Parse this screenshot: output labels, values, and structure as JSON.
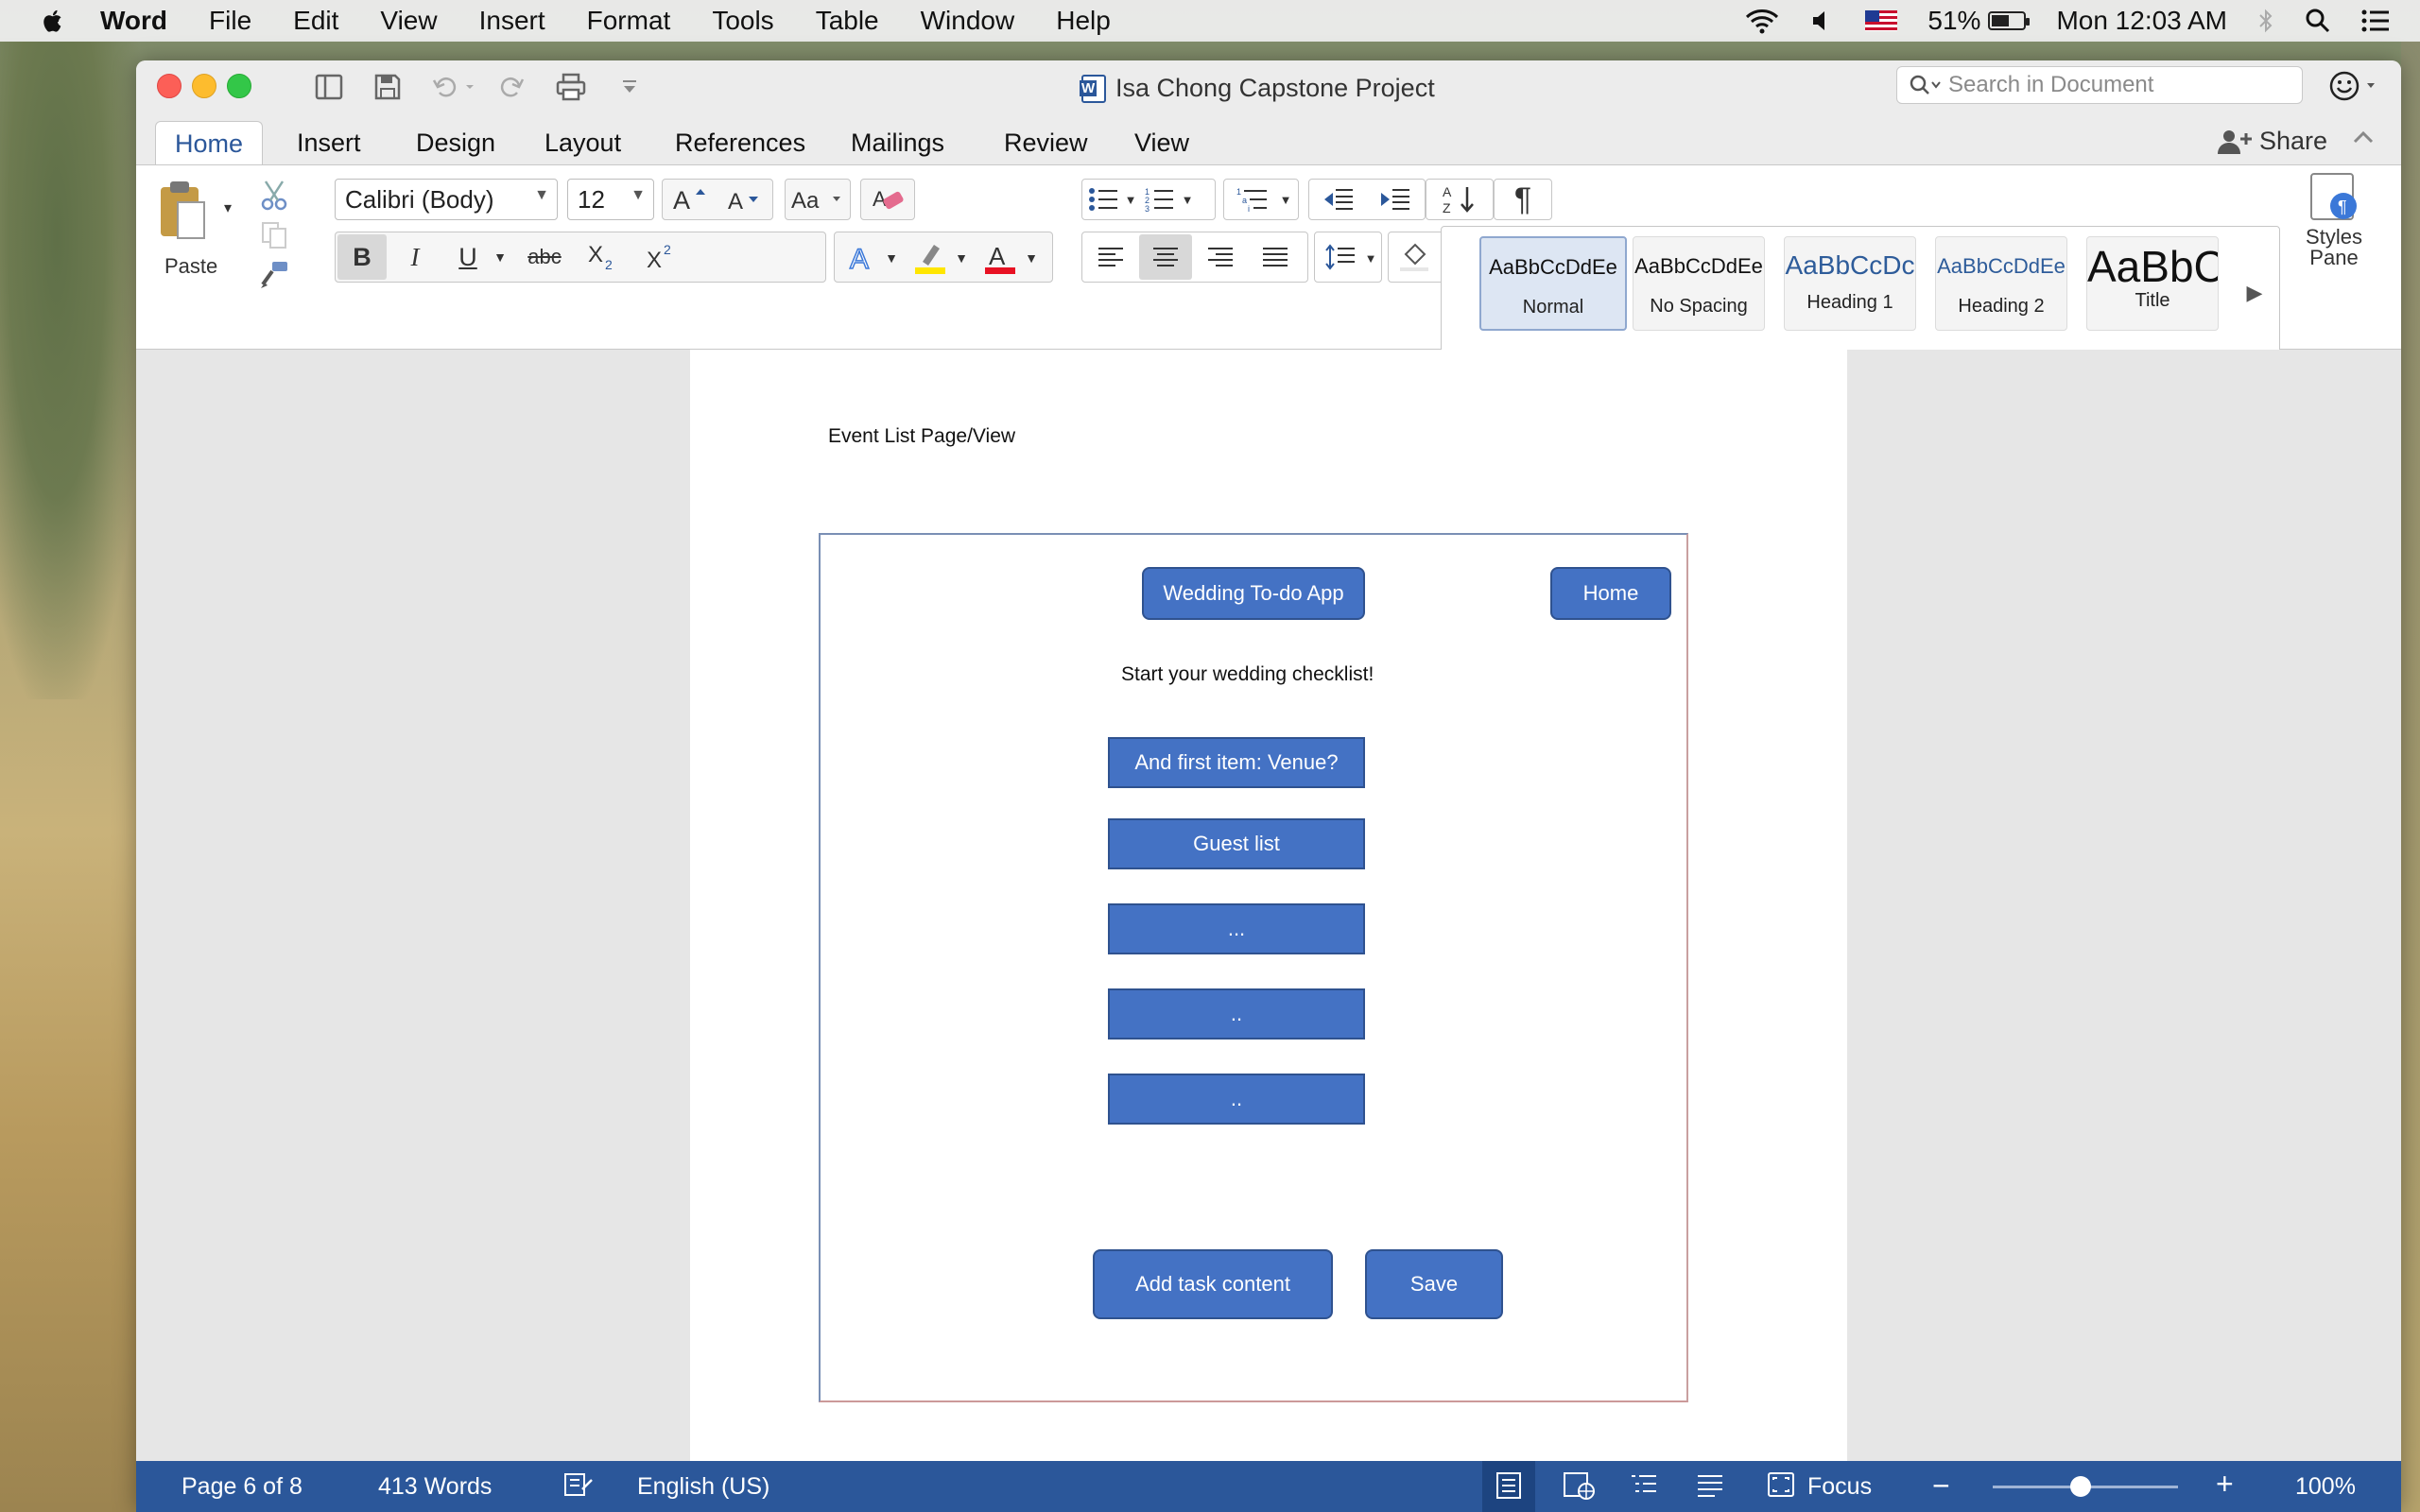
{
  "menubar": {
    "app": "Word",
    "items": [
      "File",
      "Edit",
      "View",
      "Insert",
      "Format",
      "Tools",
      "Table",
      "Window",
      "Help"
    ],
    "battery": "51%",
    "clock": "Mon 12:03 AM"
  },
  "window": {
    "title": "Isa Chong Capstone Project",
    "search_placeholder": "Search in Document",
    "share": "Share"
  },
  "tabs": [
    "Home",
    "Insert",
    "Design",
    "Layout",
    "References",
    "Mailings",
    "Review",
    "View"
  ],
  "ribbon": {
    "paste": "Paste",
    "font_name": "Calibri (Body)",
    "font_size": "12",
    "styles": [
      {
        "sample": "AaBbCcDdEe",
        "name": "Normal"
      },
      {
        "sample": "AaBbCcDdEe",
        "name": "No Spacing"
      },
      {
        "sample": "AaBbCcDc",
        "name": "Heading 1"
      },
      {
        "sample": "AaBbCcDdEe",
        "name": "Heading 2"
      },
      {
        "sample": "AaBbC",
        "name": "Title"
      }
    ],
    "styles_pane": "Styles Pane",
    "accent_color": "#2b579a",
    "highlight_color": "#ffe600",
    "font_color": "#e81123"
  },
  "document": {
    "heading": "Event List Page/View",
    "mockup": {
      "app_title_button": "Wedding To-do App",
      "home_button": "Home",
      "prompt": "Start your wedding checklist!",
      "items": [
        "And first item: Venue?",
        "Guest list",
        "...",
        "..",
        ".."
      ],
      "add_button": "Add task content",
      "save_button": "Save",
      "button_color": "#4472c4"
    }
  },
  "statusbar": {
    "page": "Page 6 of 8",
    "words": "413 Words",
    "language": "English (US)",
    "focus": "Focus",
    "zoom": "100%"
  }
}
